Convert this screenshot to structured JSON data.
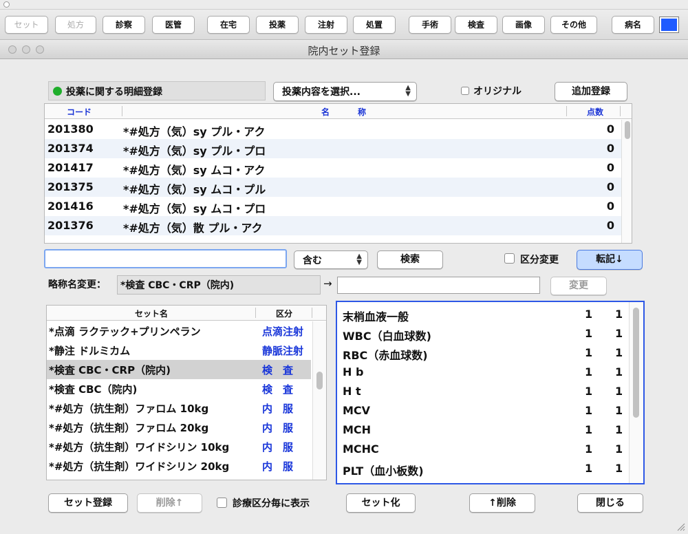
{
  "toolbar": {
    "buttons": [
      {
        "label": "セット"
      },
      {
        "label": "処方"
      },
      {
        "label": "診察"
      },
      {
        "label": "医管"
      },
      {
        "label": "在宅"
      },
      {
        "label": "投薬"
      },
      {
        "label": "注射"
      },
      {
        "label": "処置"
      },
      {
        "label": "手術"
      },
      {
        "label": "検査"
      },
      {
        "label": "画像"
      },
      {
        "label": "その他"
      },
      {
        "label": "病名"
      }
    ],
    "color_swatch": "#1f5bff"
  },
  "window": {
    "title": "院内セット登録"
  },
  "status": {
    "label": "投薬に関する明細登録",
    "indicator_color": "#1fae2b"
  },
  "content_select": {
    "value": "投薬内容を選択..."
  },
  "original_checkbox": {
    "label": "オリジナル",
    "checked": false
  },
  "add_button": {
    "label": "追加登録"
  },
  "code_table": {
    "headers": {
      "code": "コード",
      "name_left": "名",
      "name_right": "称",
      "points": "点数"
    },
    "rows": [
      {
        "code": "201380",
        "name": "*#処方（気）sy プル・アク",
        "points": "0"
      },
      {
        "code": "201374",
        "name": "*#処方（気）sy プル・プロ",
        "points": "0"
      },
      {
        "code": "201417",
        "name": "*#処方（気）sy ムコ・アク",
        "points": "0"
      },
      {
        "code": "201375",
        "name": "*#処方（気）sy ムコ・プル",
        "points": "0"
      },
      {
        "code": "201416",
        "name": "*#処方（気）sy ムコ・プロ",
        "points": "0"
      },
      {
        "code": "201376",
        "name": "*#処方（気）散 プル・アク",
        "points": "0"
      }
    ]
  },
  "search": {
    "value": "",
    "match_mode": "含む",
    "search_button": "検索",
    "kubun_checkbox_label": "区分変更",
    "transfer_button": "転記↓"
  },
  "abbreviation": {
    "label": "略称名変更：",
    "current": "*検査 CBC・CRP（院内)",
    "arrow": "→",
    "new_value": "",
    "change_button": "変更"
  },
  "set_table": {
    "headers": {
      "name": "セット名",
      "kubun": "区分"
    },
    "rows": [
      {
        "name": "*点滴 ラクテック+プリンペラン",
        "kubun": "点滴注射"
      },
      {
        "name": "*静注 ドルミカム",
        "kubun": "静脈注射"
      },
      {
        "name": "*検査 CBC・CRP（院内)",
        "kubun": "検　査"
      },
      {
        "name": "*検査 CBC（院内)",
        "kubun": "検　査"
      },
      {
        "name": "*#処方（抗生剤）ファロム 10kg",
        "kubun": "内　服"
      },
      {
        "name": "*#処方（抗生剤）ファロム 20kg",
        "kubun": "内　服"
      },
      {
        "name": "*#処方（抗生剤）ワイドシリン 10kg",
        "kubun": "内　服"
      },
      {
        "name": "*#処方（抗生剤）ワイドシリン 20kg",
        "kubun": "内　服"
      }
    ]
  },
  "detail_table": {
    "rows": [
      {
        "name": "末梢血液一般",
        "a": "1",
        "b": "1"
      },
      {
        "name": "WBC（白血球数)",
        "a": "1",
        "b": "1"
      },
      {
        "name": "RBC（赤血球数)",
        "a": "1",
        "b": "1"
      },
      {
        "name": "H b",
        "a": "1",
        "b": "1"
      },
      {
        "name": "H t",
        "a": "1",
        "b": "1"
      },
      {
        "name": "MCV",
        "a": "1",
        "b": "1"
      },
      {
        "name": "MCH",
        "a": "1",
        "b": "1"
      },
      {
        "name": "MCHC",
        "a": "1",
        "b": "1"
      },
      {
        "name": "PLT（血小板数)",
        "a": "1",
        "b": "1"
      }
    ]
  },
  "bottom": {
    "set_register": "セット登録",
    "delete_up": "削除↑",
    "show_by_kubun_label": "診療区分毎に表示",
    "make_set": "セット化",
    "delete_detail": "↑削除",
    "close": "閉じる"
  }
}
